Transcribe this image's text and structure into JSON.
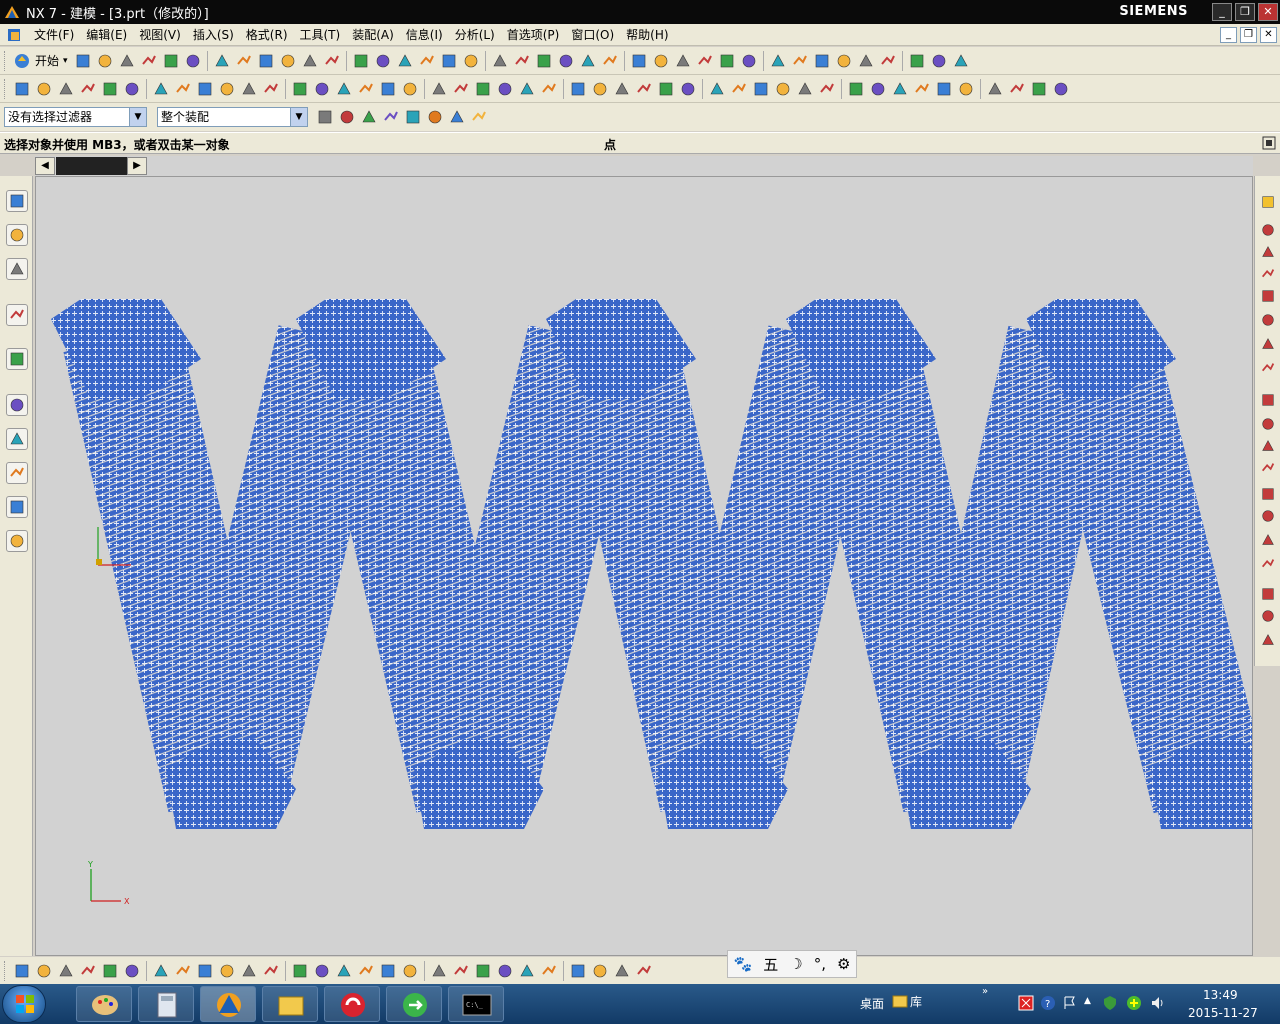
{
  "window": {
    "title": "NX 7 - 建模 - [3.prt（修改的）]",
    "brand": "SIEMENS",
    "controls": [
      "_",
      "❐",
      "✕"
    ]
  },
  "menubar": {
    "items": [
      "文件(F)",
      "编辑(E)",
      "视图(V)",
      "插入(S)",
      "格式(R)",
      "工具(T)",
      "装配(A)",
      "信息(I)",
      "分析(L)",
      "首选项(P)",
      "窗口(O)",
      "帮助(H)"
    ]
  },
  "toolbar1": {
    "start_label": "开始"
  },
  "selection": {
    "filter_value": "没有选择过滤器",
    "scope_value": "整个装配"
  },
  "cue": {
    "prompt": "选择对象并使用 MB3，或者双击某一对象",
    "status": "点"
  },
  "graphics": {
    "background": "#d2d2d2",
    "geometry_color": "#3a66c8",
    "mesh_color": "#ffffff",
    "triad_axes": [
      "Y",
      "X"
    ]
  },
  "ime": {
    "items": [
      "🐾",
      "五",
      "☽",
      "°,",
      "⚙"
    ]
  },
  "taskbar": {
    "desktop_label": "桌面",
    "library_label": "库",
    "time": "13:49",
    "date": "2015-11-27"
  }
}
